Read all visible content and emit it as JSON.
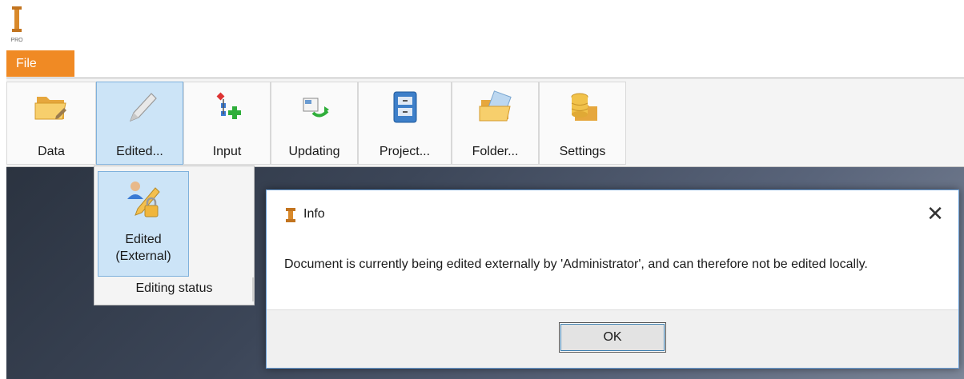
{
  "app": {
    "logo_icon": "app-logo-icon",
    "logo_text": "PRO"
  },
  "menu": {
    "file_label": "File"
  },
  "ribbon": {
    "buttons": [
      {
        "label": "Data",
        "icon": "folder-edit-icon"
      },
      {
        "label": "Edited...",
        "icon": "pencil-icon",
        "active": true
      },
      {
        "label": "Input",
        "icon": "input-add-icon"
      },
      {
        "label": "Updating",
        "icon": "update-icon"
      },
      {
        "label": "Project...",
        "icon": "project-icon"
      },
      {
        "label": "Folder...",
        "icon": "folder-open-icon"
      },
      {
        "label": "Settings",
        "icon": "database-folder-icon"
      }
    ]
  },
  "dropdown": {
    "item_label_line1": "Edited",
    "item_label_line2": "(External)",
    "item_icon": "user-pencil-lock-icon",
    "group_label": "Editing status"
  },
  "dialog": {
    "title": "Info",
    "message": "Document is currently being edited externally by 'Administrator', and can therefore not be edited locally.",
    "ok_label": "OK"
  },
  "colors": {
    "file_tab": "#f08a24",
    "active_button": "#cce4f7",
    "dialog_border": "#6aa0d8"
  }
}
